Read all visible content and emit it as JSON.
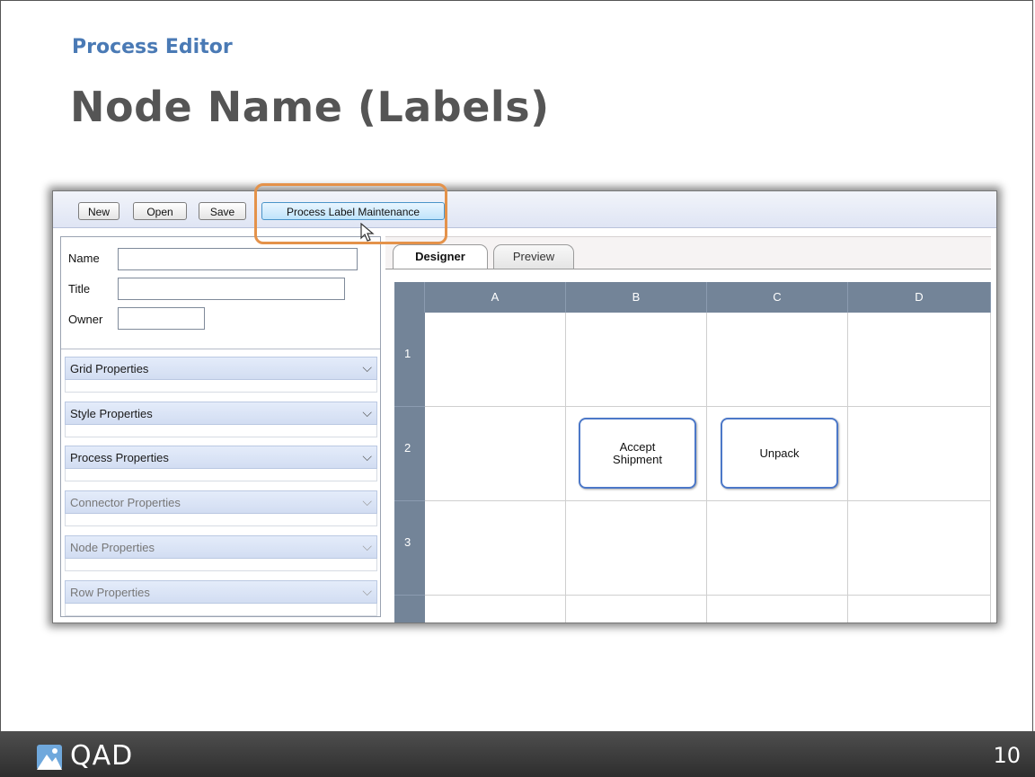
{
  "slide": {
    "section_title": "Process Editor",
    "title": "Node Name (Labels)",
    "page_number": "10",
    "logo_text": "QAD"
  },
  "toolbar": {
    "buttons": [
      {
        "label": "New"
      },
      {
        "label": "Open"
      },
      {
        "label": "Save"
      },
      {
        "label": "Process Label Maintenance"
      }
    ]
  },
  "form": {
    "name_label": "Name",
    "title_label": "Title",
    "owner_label": "Owner",
    "name_value": "",
    "title_value": "",
    "owner_value": ""
  },
  "sections": [
    {
      "label": "Grid Properties",
      "enabled": true
    },
    {
      "label": "Style Properties",
      "enabled": true
    },
    {
      "label": "Process Properties",
      "enabled": true
    },
    {
      "label": "Connector Properties",
      "enabled": false
    },
    {
      "label": "Node Properties",
      "enabled": false
    },
    {
      "label": "Row Properties",
      "enabled": false
    }
  ],
  "tabs": [
    {
      "label": "Designer",
      "active": true
    },
    {
      "label": "Preview",
      "active": false
    }
  ],
  "grid": {
    "columns": [
      "A",
      "B",
      "C",
      "D"
    ],
    "rows": [
      "1",
      "2",
      "3",
      ""
    ],
    "nodes": [
      {
        "label": "Accept\nShipment",
        "col": "B",
        "row": "2"
      },
      {
        "label": "Unpack",
        "col": "C",
        "row": "2"
      }
    ]
  },
  "colors": {
    "accent": "#4a7ab5",
    "highlight_ring": "#e4924a",
    "grid_header": "#738498",
    "node_border": "#4c78c8"
  }
}
